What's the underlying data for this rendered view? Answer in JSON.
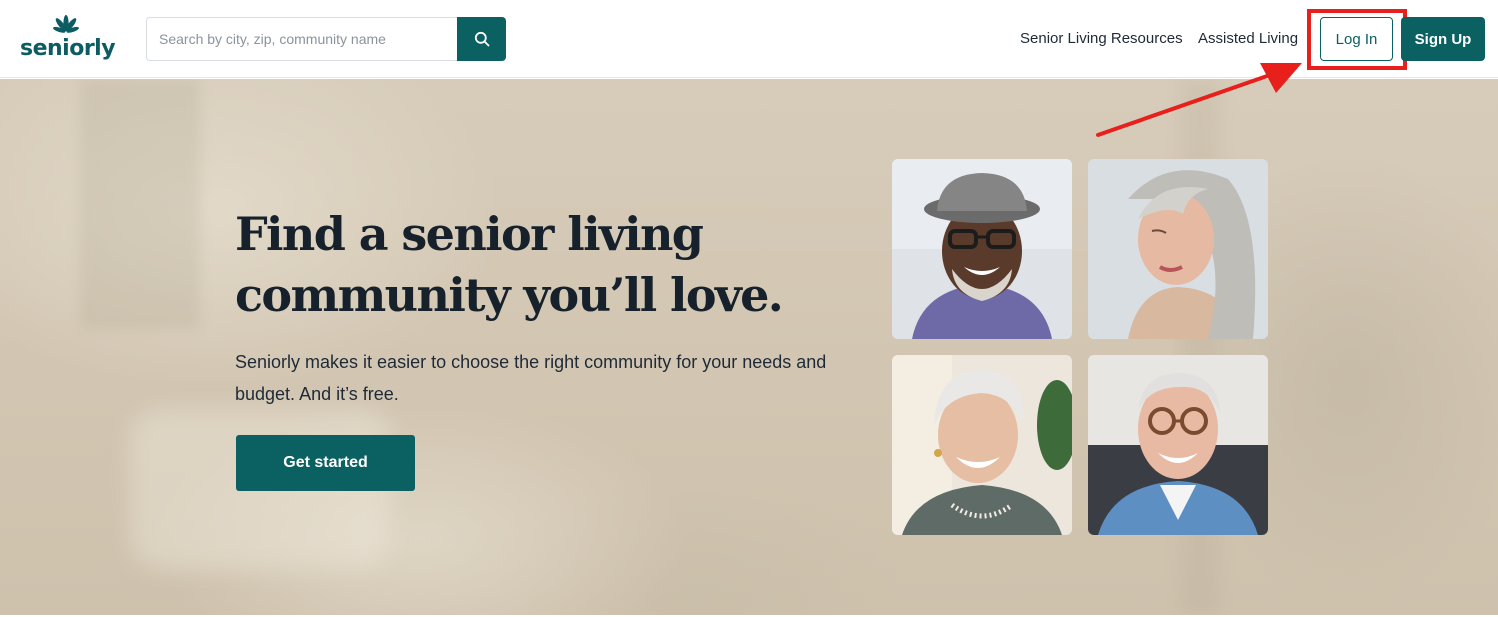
{
  "brand": {
    "name": "seniorly",
    "color": "#0b6062"
  },
  "search": {
    "placeholder": "Search by city, zip, community name",
    "icon": "search-icon"
  },
  "nav": {
    "links": [
      "Senior Living Resources",
      "Assisted Living"
    ],
    "login_label": "Log In",
    "signup_label": "Sign Up"
  },
  "hero": {
    "title": "Find a senior living community you’ll love.",
    "subtitle": "Seniorly makes it easier to choose the right community for your needs and budget. And it’s free.",
    "cta_label": "Get started",
    "photos": [
      "smiling-man-with-hat-photo",
      "woman-with-gray-hair-photo",
      "smiling-older-woman-photo",
      "smiling-man-with-glasses-photo"
    ]
  },
  "annotation": {
    "highlight_color": "#e8201c",
    "target": "log-in-button"
  }
}
